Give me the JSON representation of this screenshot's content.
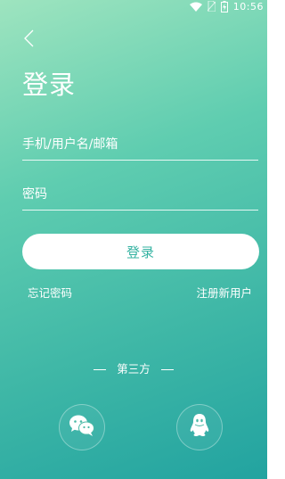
{
  "status_bar": {
    "time": "10:56",
    "icons": [
      "wifi-icon",
      "no-sim-icon",
      "battery-icon"
    ]
  },
  "header": {
    "back_icon": "chevron-left-icon",
    "title": "登录"
  },
  "form": {
    "account_placeholder": "手机/用户名/邮箱",
    "account_value": "",
    "password_placeholder": "密码",
    "password_value": "",
    "login_label": "登录"
  },
  "links": {
    "forgot_password": "忘记密码",
    "register": "注册新用户"
  },
  "third_party": {
    "label": "第三方",
    "providers": [
      "wechat-icon",
      "qq-icon"
    ]
  },
  "colors": {
    "gradient_start": "#9ee4bf",
    "gradient_end": "#22a3a0",
    "button_text": "#35b3a2",
    "foreground": "#ffffff"
  }
}
